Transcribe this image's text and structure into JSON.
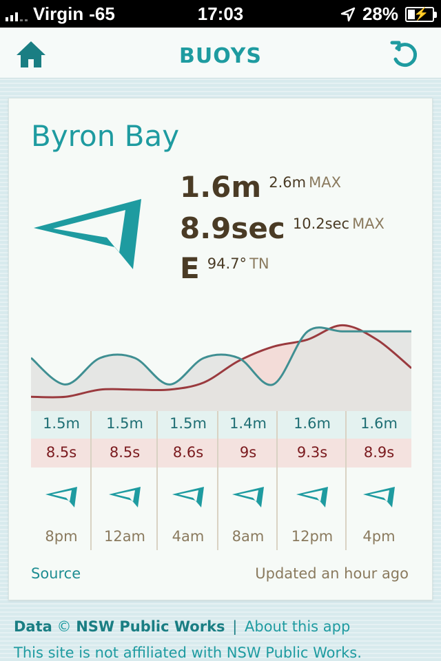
{
  "status_bar": {
    "carrier": "Virgin",
    "signal": "-65",
    "time": "17:03",
    "battery": "28%",
    "battery_level": 0.28
  },
  "nav": {
    "title": "BUOYS",
    "home_icon": "home-icon",
    "refresh_icon": "refresh-icon"
  },
  "buoy": {
    "location": "Byron Bay",
    "wave_height": "1.6m",
    "wave_height_max": "2.6m",
    "period": "8.9sec",
    "period_max": "10.2sec",
    "max_label": "MAX",
    "direction": "E",
    "direction_degrees": "94.7°",
    "direction_ref": "TN"
  },
  "forecast": [
    {
      "height": "1.5m",
      "period": "8.5s",
      "time": "8pm"
    },
    {
      "height": "1.5m",
      "period": "8.5s",
      "time": "12am"
    },
    {
      "height": "1.5m",
      "period": "8.6s",
      "time": "4am"
    },
    {
      "height": "1.4m",
      "period": "9s",
      "time": "8am"
    },
    {
      "height": "1.6m",
      "period": "9.3s",
      "time": "12pm"
    },
    {
      "height": "1.6m",
      "period": "8.9s",
      "time": "4pm"
    }
  ],
  "colors": {
    "accent": "#1e9ba0",
    "height_line": "#3f8f92",
    "period_line": "#9a3a3e",
    "period_fill": "#f3dcd8",
    "grey_fill": "#e3e3e1"
  },
  "chart_data": {
    "type": "line",
    "series": [
      {
        "values": [
          1.5,
          1.4,
          1.5,
          1.5,
          1.4,
          1.5,
          1.5,
          1.4,
          1.6,
          1.6,
          1.6,
          1.6
        ]
      },
      {
        "values": [
          8.5,
          8.5,
          8.6,
          8.6,
          8.6,
          8.7,
          9.0,
          9.2,
          9.3,
          9.5,
          9.3,
          8.9
        ]
      }
    ]
  },
  "footer": {
    "data_label": "Data",
    "copyright": "©",
    "owner": "NSW Public Works",
    "separator": "|",
    "about_link": "About this app",
    "disclaimer": "This site is not affiliated with NSW Public Works."
  },
  "source_link": "Source",
  "updated": "Updated an hour ago"
}
